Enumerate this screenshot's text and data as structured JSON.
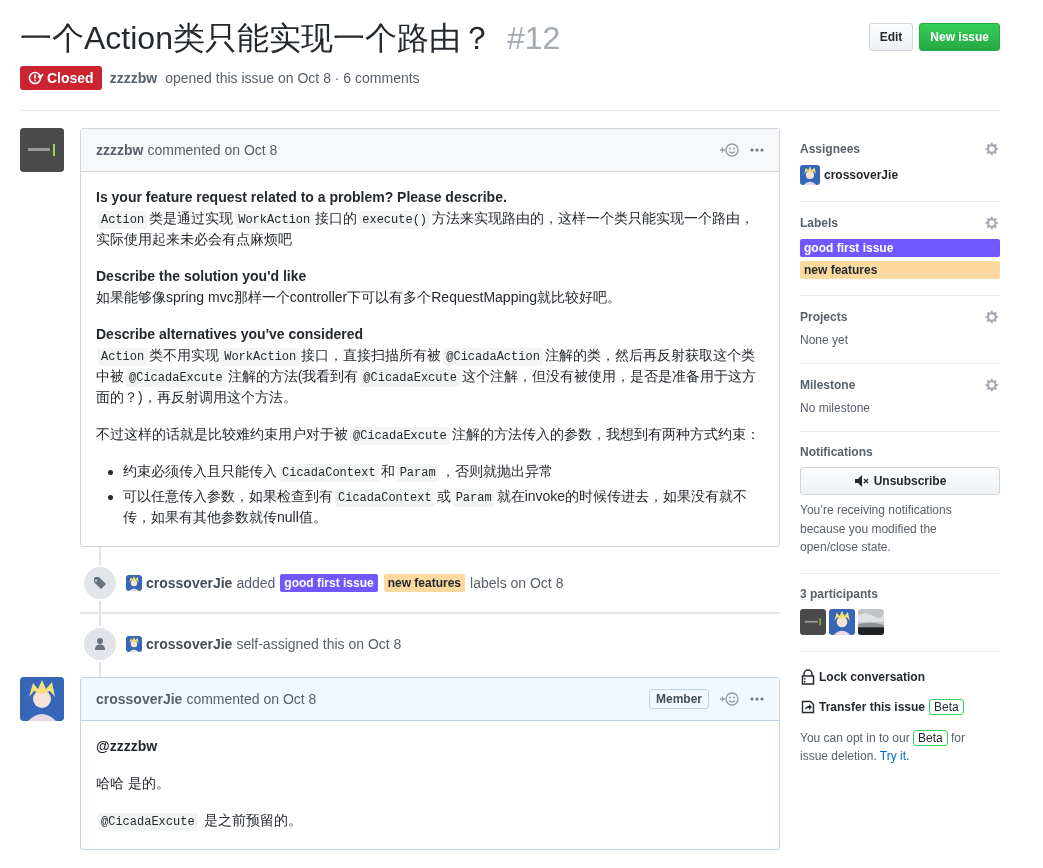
{
  "issue": {
    "title": "一个Action类只能实现一个路由？",
    "number": "#12",
    "state_label": "Closed",
    "author": "zzzzbw",
    "meta": "opened this issue on Oct 8 · 6 comments"
  },
  "header_buttons": [
    {
      "label": "Edit",
      "kind": "default"
    },
    {
      "label": "New issue",
      "kind": "primary"
    }
  ],
  "timeline": [
    {
      "kind": "comment",
      "author": "zzzzbw",
      "action": "commented on Oct 8",
      "highlighted": false,
      "blocks": [
        {
          "kind": "paragraph",
          "parts": [
            {
              "kind": "bold",
              "text": "Is your feature request related to a problem? Please describe."
            },
            {
              "kind": "break"
            },
            {
              "kind": "code",
              "text": "Action"
            },
            {
              "kind": "text",
              "text": "类是通过实现"
            },
            {
              "kind": "code",
              "text": "WorkAction"
            },
            {
              "kind": "text",
              "text": "接口的"
            },
            {
              "kind": "code",
              "text": "execute()"
            },
            {
              "kind": "text",
              "text": "方法来实现路由的，这样一个类只能实现一个路由，实际使用起来未必会有点麻烦吧"
            }
          ]
        },
        {
          "kind": "paragraph",
          "parts": [
            {
              "kind": "bold",
              "text": "Describe the solution you'd like"
            },
            {
              "kind": "break"
            },
            {
              "kind": "text",
              "text": "如果能够像spring mvc那样一个controller下可以有多个RequestMapping就比较好吧。"
            }
          ]
        },
        {
          "kind": "paragraph",
          "parts": [
            {
              "kind": "bold",
              "text": "Describe alternatives you've considered"
            },
            {
              "kind": "break"
            },
            {
              "kind": "code",
              "text": "Action"
            },
            {
              "kind": "text",
              "text": "类不用实现"
            },
            {
              "kind": "code",
              "text": "WorkAction"
            },
            {
              "kind": "text",
              "text": "接口，直接扫描所有被"
            },
            {
              "kind": "code",
              "text": "@CicadaAction"
            },
            {
              "kind": "text",
              "text": "注解的类，然后再反射获取这个类中被"
            },
            {
              "kind": "code",
              "text": "@CicadaExcute"
            },
            {
              "kind": "text",
              "text": "注解的方法(我看到有"
            },
            {
              "kind": "code",
              "text": "@CicadaExcute"
            },
            {
              "kind": "text",
              "text": "这个注解，但没有被使用，是否是准备用于这方面的？)，再反射调用这个方法。"
            }
          ]
        },
        {
          "kind": "paragraph",
          "parts": [
            {
              "kind": "text",
              "text": "不过这样的话就是比较难约束用户对于被"
            },
            {
              "kind": "code",
              "text": "@CicadaExcute"
            },
            {
              "kind": "text",
              "text": "注解的方法传入的参数，我想到有两种方式约束："
            }
          ]
        },
        {
          "kind": "list",
          "items": [
            {
              "parts": [
                {
                  "kind": "text",
                  "text": "约束必须传入且只能传入"
                },
                {
                  "kind": "code",
                  "text": "CicadaContext"
                },
                {
                  "kind": "text",
                  "text": "和"
                },
                {
                  "kind": "code",
                  "text": "Param"
                },
                {
                  "kind": "text",
                  "text": "，否则就抛出异常"
                }
              ]
            },
            {
              "parts": [
                {
                  "kind": "text",
                  "text": "可以任意传入参数，如果检查到有"
                },
                {
                  "kind": "code",
                  "text": "CicadaContext"
                },
                {
                  "kind": "text",
                  "text": "或"
                },
                {
                  "kind": "code",
                  "text": "Param"
                },
                {
                  "kind": "text",
                  "text": "就在invoke的时候传进去，如果没有就不传，如果有其他参数就传null值。"
                }
              ]
            }
          ]
        }
      ]
    },
    {
      "kind": "labeled",
      "actor": "crossoverJie",
      "text": "added",
      "labels": [
        {
          "name": "good first issue",
          "color": "#7057ff"
        },
        {
          "name": "new features",
          "color": "#fbd99f"
        }
      ],
      "suffix": "labels on Oct 8"
    },
    {
      "kind": "assigned",
      "actor": "crossoverJie",
      "suffix": "self-assigned this on Oct 8"
    },
    {
      "kind": "comment",
      "author": "crossoverJie",
      "action": "commented on Oct 8",
      "badge": "Member",
      "highlighted": true,
      "blocks": [
        {
          "kind": "paragraph",
          "parts": [
            {
              "kind": "bold",
              "text": "@zzzzbw"
            }
          ]
        },
        {
          "kind": "paragraph",
          "parts": [
            {
              "kind": "text",
              "text": "哈哈 是的。"
            }
          ]
        },
        {
          "kind": "paragraph",
          "parts": [
            {
              "kind": "code",
              "text": "@CicadaExcute"
            },
            {
              "kind": "text",
              "text": " 是之前预留的。"
            }
          ]
        }
      ]
    }
  ],
  "sidebar": {
    "assignees": {
      "heading": "Assignees",
      "people": [
        {
          "name": "crossoverJie"
        }
      ]
    },
    "labels": {
      "heading": "Labels",
      "items": [
        {
          "name": "good first issue",
          "color": "#7057ff"
        },
        {
          "name": "new features",
          "color": "#fbd99f"
        }
      ]
    },
    "projects": {
      "heading": "Projects",
      "value": "None yet"
    },
    "milestone": {
      "heading": "Milestone",
      "value": "No milestone"
    },
    "notifications": {
      "heading": "Notifications",
      "button": "Unsubscribe",
      "note": "You’re receiving notifications because you modified the open/close state."
    },
    "participants": {
      "heading": "3 participants",
      "avatars": [
        {
          "kind": "avatar"
        },
        {
          "kind": "avatar"
        },
        {
          "kind": "picture"
        }
      ]
    },
    "actions": [
      {
        "label": "Lock conversation"
      },
      {
        "label": "Transfer this issue",
        "badge": "Beta"
      }
    ],
    "deletion_note": {
      "before": "You can opt in to our",
      "badge": "Beta",
      "after": "for issue deletion.",
      "link": "Try it."
    }
  }
}
